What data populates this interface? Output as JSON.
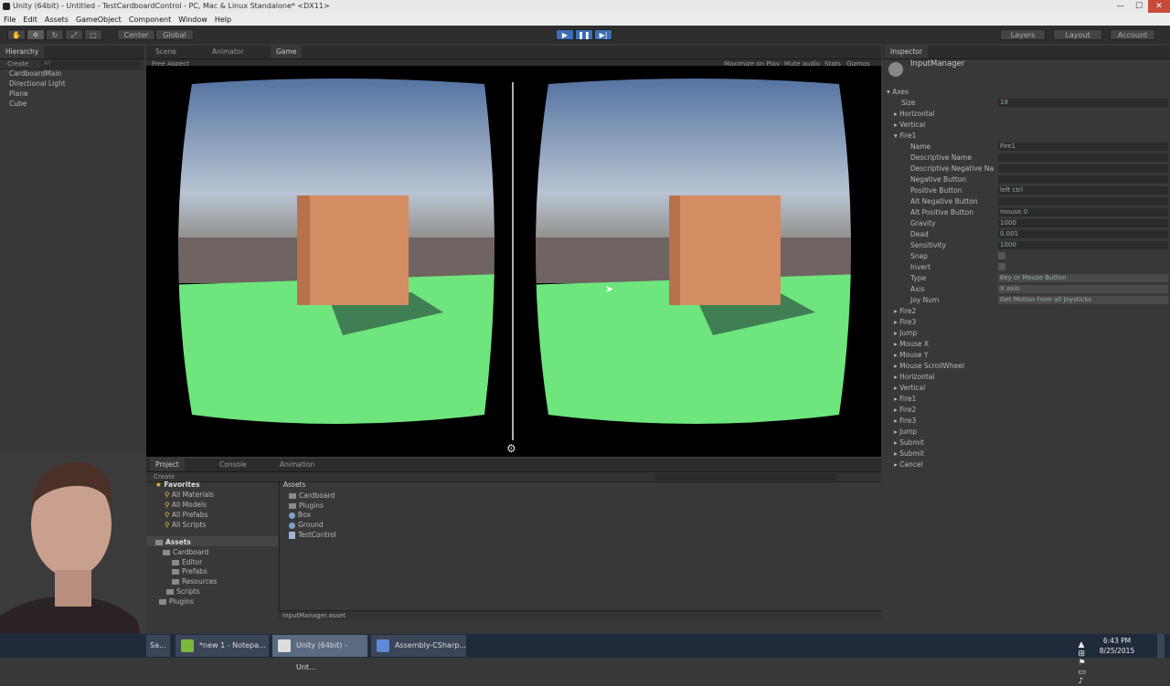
{
  "window": {
    "title": "Unity (64bit) - Untitled - TestCardboardControl - PC, Mac & Linux Standalone* <DX11>"
  },
  "menu": [
    "File",
    "Edit",
    "Assets",
    "GameObject",
    "Component",
    "Window",
    "Help"
  ],
  "toolbar": {
    "center": "Center",
    "global": "Global",
    "layers": "Layers",
    "layout": "Layout",
    "account": "Account"
  },
  "hierarchy": {
    "tab": "Hierarchy",
    "create": "Create",
    "search_placeholder": "All",
    "items": [
      "CardboardMain",
      "Directional Light",
      "Plane",
      "Cube"
    ]
  },
  "scene_tabs": [
    "Scene",
    "Animator",
    "Game"
  ],
  "game": {
    "aspect": "Free Aspect",
    "options": [
      "Maximize on Play",
      "Mute audio",
      "Stats",
      "Gizmos"
    ]
  },
  "inspector": {
    "tab": "Inspector",
    "object": "InputManager",
    "axes_label": "Axes",
    "size_label": "Size",
    "size_value": "18",
    "fields": [
      {
        "label": "Name",
        "value": "Fire1"
      },
      {
        "label": "Descriptive Name",
        "value": ""
      },
      {
        "label": "Descriptive Negative Na",
        "value": ""
      },
      {
        "label": "Negative Button",
        "value": ""
      },
      {
        "label": "Positive Button",
        "value": "left ctrl"
      },
      {
        "label": "Alt Negative Button",
        "value": ""
      },
      {
        "label": "Alt Positive Button",
        "value": "mouse 0"
      },
      {
        "label": "Gravity",
        "value": "1000"
      },
      {
        "label": "Dead",
        "value": "0.001"
      },
      {
        "label": "Sensitivity",
        "value": "1000"
      },
      {
        "label": "Snap",
        "value": ""
      },
      {
        "label": "Invert",
        "value": ""
      },
      {
        "label": "Type",
        "value": "Key or Mouse Button"
      },
      {
        "label": "Axis",
        "value": "X axis"
      },
      {
        "label": "Joy Num",
        "value": "Get Motion from all Joysticks"
      }
    ],
    "axes_before": [
      "Horizontal",
      "Vertical",
      "Fire1"
    ],
    "axes_after": [
      "Fire2",
      "Fire3",
      "Jump",
      "Mouse X",
      "Mouse Y",
      "Mouse ScrollWheel",
      "Horizontal",
      "Vertical",
      "Fire1",
      "Fire2",
      "Fire3",
      "Jump",
      "Submit",
      "Submit",
      "Cancel"
    ]
  },
  "project": {
    "tabs": [
      "Project",
      "Console",
      "Animation"
    ],
    "create": "Create",
    "favorites_label": "Favorites",
    "favorites": [
      "All Materials",
      "All Models",
      "All Prefabs",
      "All Scripts"
    ],
    "assets_label": "Assets",
    "tree": [
      "Cardboard",
      "Editor",
      "Prefabs",
      "Resources",
      "Scripts",
      "Plugins"
    ],
    "breadcrumb": "Assets",
    "files": [
      "Cardboard",
      "Plugins",
      "Box",
      "Ground",
      "TestControl"
    ],
    "footer": "InputManager.asset"
  },
  "taskbar": {
    "tasks": [
      "Sa...",
      "*new 1 - Notepa...",
      "Unity (64bit) - Unt...",
      "Assembly-CSharp..."
    ],
    "time": "6:43 PM",
    "date": "8/25/2015"
  }
}
